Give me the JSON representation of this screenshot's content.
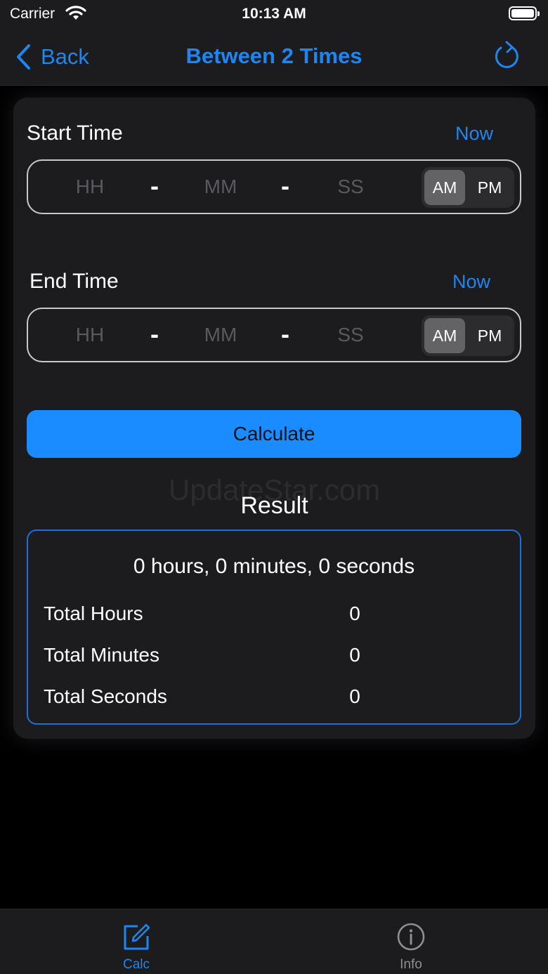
{
  "status_bar": {
    "carrier": "Carrier",
    "time": "10:13 AM"
  },
  "nav": {
    "back_label": "Back",
    "title": "Between 2 Times"
  },
  "start": {
    "label": "Start Time",
    "now_label": "Now",
    "hh_placeholder": "HH",
    "mm_placeholder": "MM",
    "ss_placeholder": "SS",
    "separator": "-",
    "am": "AM",
    "pm": "PM",
    "selected_period": "AM"
  },
  "end": {
    "label": "End Time",
    "now_label": "Now",
    "hh_placeholder": "HH",
    "mm_placeholder": "MM",
    "ss_placeholder": "SS",
    "separator": "-",
    "am": "AM",
    "pm": "PM",
    "selected_period": "AM"
  },
  "calculate_label": "Calculate",
  "watermark": "UpdateStar.com",
  "result": {
    "label": "Result",
    "summary": "0 hours, 0 minutes,  0 seconds",
    "rows": [
      {
        "label": "Total Hours",
        "value": "0"
      },
      {
        "label": "Total Minutes",
        "value": "0"
      },
      {
        "label": "Total Seconds",
        "value": "0"
      }
    ]
  },
  "tabs": [
    {
      "label": "Calc",
      "icon": "edit-icon",
      "active": true
    },
    {
      "label": "Info",
      "icon": "info-icon",
      "active": false
    }
  ],
  "colors": {
    "accent": "#1e86f0",
    "button": "#1a8cff",
    "inactive": "#8e8e93"
  }
}
